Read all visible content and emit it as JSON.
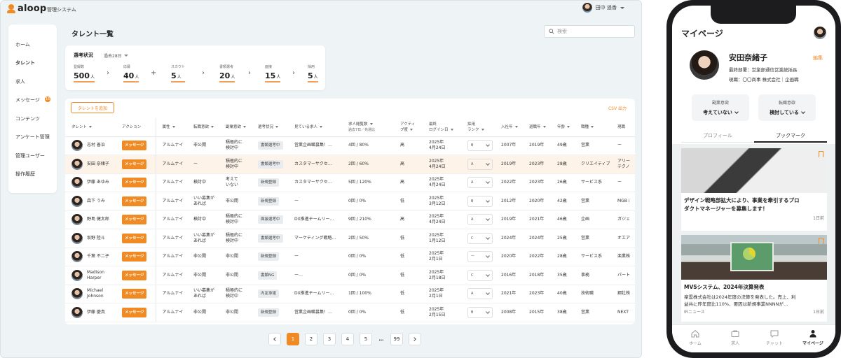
{
  "app": {
    "logo_text": "aloop",
    "system_name": "管理システム",
    "user_name": "田中 遥香"
  },
  "sidebar": {
    "items": [
      {
        "label": "ホーム"
      },
      {
        "label": "タレント",
        "active": true
      },
      {
        "label": "求人"
      },
      {
        "label": "メッセージ",
        "badge": "16"
      },
      {
        "label": "コンテンツ"
      },
      {
        "label": "アンケート管理"
      },
      {
        "label": "管理ユーザー"
      },
      {
        "label": "操作履歴"
      }
    ]
  },
  "page": {
    "title": "タレント一覧",
    "search_placeholder": "検索"
  },
  "status": {
    "title": "選考状況",
    "period": "過去28日",
    "stats": [
      {
        "label": "登録数",
        "value": "500",
        "unit": "人"
      },
      {
        "label": "応募",
        "value": "40",
        "unit": "人"
      },
      {
        "label": "スカウト",
        "value": "5",
        "unit": "人"
      },
      {
        "label": "書類選考",
        "value": "20",
        "unit": "人"
      },
      {
        "label": "面接",
        "value": "15",
        "unit": "人"
      },
      {
        "label": "採用",
        "value": "5",
        "unit": "人"
      }
    ]
  },
  "list": {
    "add_button": "タレントを追加",
    "csv_link": "CSV 出力",
    "headers": {
      "talent": "タレント",
      "action": "アクション",
      "attribute": "属性",
      "job_change": "転職意欲",
      "side_job": "副業意欲",
      "status": "選考状況",
      "viewing": "見ている求人",
      "views_1": "求人閲覧数",
      "views_2": "過去7日／先週比",
      "activity_1": "アクティ",
      "activity_2": "ブ度",
      "last_login_1": "最終",
      "last_login_2": "ログイン日",
      "rank_1": "採用",
      "rank_2": "ランク",
      "join_year": "入社年",
      "leave_year": "退職年",
      "age": "年齢",
      "occupation": "職種",
      "current": "現職"
    },
    "message_label": "メッセージ",
    "rows": [
      {
        "name": "志村 善治",
        "attr": "アルムナイ",
        "job": "非公開",
        "side": "積極的に\n検討中",
        "status": "書類選考中",
        "viewing": "営業企画職募集！…",
        "views": "4回 / 80%",
        "activity": "高",
        "login": "2025年\n4月24日",
        "rank": "B",
        "join": "2007年",
        "leave": "2019年",
        "age": "49歳",
        "occ": "営業",
        "cur": "ー"
      },
      {
        "name": "安田 奈緒子",
        "attr": "アルムナイ",
        "job": "ー",
        "side": "積極的に\n検討中",
        "status": "書類選考中",
        "viewing": "カスタマーサクセ…",
        "views": "2回 / 60%",
        "activity": "高",
        "login": "2025年\n4月24日",
        "rank": "A",
        "join": "2019年",
        "leave": "2023年",
        "age": "28歳",
        "occ": "クリエイティブ",
        "cur": "アリー\nテクノ",
        "highlight": true
      },
      {
        "name": "伊藤 あゆみ",
        "attr": "アルムナイ",
        "job": "検討中",
        "side": "考えて\nいない",
        "status": "新規登録",
        "viewing": "カスタマーサクセ…",
        "views": "5回 / 120%",
        "activity": "高",
        "login": "2025年\n4月24日",
        "rank": "A",
        "join": "2022年",
        "leave": "2023年",
        "age": "26歳",
        "occ": "サービス系",
        "cur": "ー"
      },
      {
        "name": "森下 うみ",
        "attr": "アルムナイ",
        "job": "いい募集が\nあれば",
        "side": "非公開",
        "status": "新規登録",
        "viewing": "ー",
        "views": "0回 / 0%",
        "activity": "低",
        "login": "2025年\n3月12日",
        "rank": "B",
        "join": "2012年",
        "leave": "2020年",
        "age": "42歳",
        "occ": "営業",
        "cur": "MGB i"
      },
      {
        "name": "野島 健太郎",
        "attr": "アルムナイ",
        "job": "検討中",
        "side": "積極的に\n検討中",
        "status": "面接選考中",
        "viewing": "DX推進チームリー…",
        "views": "9回 / 210%",
        "activity": "高",
        "login": "2025年\n4月24日",
        "rank": "A",
        "join": "2019年",
        "leave": "2021年",
        "age": "46歳",
        "occ": "企画",
        "cur": "ガジェ"
      },
      {
        "name": "坂野 陸斗",
        "attr": "アルムナイ",
        "job": "いい募集が\nあれば",
        "side": "積極的に\n検討中",
        "status": "書類選考中",
        "viewing": "マーケティング戦略…",
        "views": "2回 / 50%",
        "activity": "低",
        "login": "2025年\n1月12日",
        "rank": "C",
        "join": "2024年",
        "leave": "2024年",
        "age": "25歳",
        "occ": "営業",
        "cur": "オエア"
      },
      {
        "name": "千葉 不二子",
        "attr": "アルムナイ",
        "job": "非公開",
        "side": "非公開",
        "status": "新規登録",
        "viewing": "ー",
        "views": "0回 / 0%",
        "activity": "低",
        "login": "2025年\n2月1日",
        "rank": "ー",
        "join": "2020年",
        "leave": "2022年",
        "age": "28歳",
        "occ": "サービス系",
        "cur": "楽業株"
      },
      {
        "name": "Madison\nHarper",
        "attr": "アルムナイ",
        "job": "非公開",
        "side": "非公開",
        "status": "書類NG",
        "viewing": "ー…",
        "views": "0回 / 0%",
        "activity": "低",
        "login": "2025年\n2月18日",
        "rank": "C",
        "join": "2016年",
        "leave": "2018年",
        "age": "35歳",
        "occ": "事務",
        "cur": "パート"
      },
      {
        "name": "Michael\nJohnson",
        "attr": "アルムナイ",
        "job": "いい募集が\nあれば",
        "side": "積極的に\n検討中",
        "status": "内定承諾",
        "viewing": "DX推進チームリー…",
        "views": "1回 / 100%",
        "activity": "低",
        "login": "2025年\n2月1日",
        "rank": "A",
        "join": "2021年",
        "leave": "2023年",
        "age": "40歳",
        "occ": "技術職",
        "cur": "鋼牡株"
      },
      {
        "name": "伊藤 慶真",
        "attr": "アルムナイ",
        "job": "非公開",
        "side": "非公開",
        "status": "新規登録",
        "viewing": "営業企画職募集！…",
        "views": "0回 / 0%",
        "activity": "低",
        "login": "2025年\n2月15日",
        "rank": "B",
        "join": "2008年",
        "leave": "2015年",
        "age": "38歳",
        "occ": "営業",
        "cur": "NEXT"
      }
    ]
  },
  "pager": {
    "pages": [
      "1",
      "2",
      "3",
      "4",
      "5",
      "…",
      "99"
    ],
    "current": "1"
  },
  "phone": {
    "title": "マイページ",
    "name": "安田奈緒子",
    "edit": "編集",
    "last_dept": "最終部署：営業部通信営業統括長",
    "current_job": "現職：〇〇商事 株式会社｜企画職",
    "side_intent_label": "副業意欲",
    "side_intent_value": "考えていない",
    "job_intent_label": "転職意欲",
    "job_intent_value": "検討している",
    "tabs": [
      "プロフィール",
      "ブックマーク"
    ],
    "articles": [
      {
        "title": "デザイン戦略部拡大により、事業を牽引するプロ\nダクトマネージャーを募集します！",
        "time": "1日前"
      },
      {
        "title": "MVSシステム、2024年決算発表",
        "body": "楽雲株式会社は2024年度の決算を発表した。売上、利\n益共に昨年度比110%、要因は新規事業NNNNが…",
        "source": "IRニュース",
        "time": "1日前"
      }
    ],
    "nav": [
      "ホーム",
      "求人",
      "チャット",
      "マイページ"
    ]
  },
  "colors": {
    "accent": "#f08a24",
    "highlight_row": "#fdf3e9",
    "tag_bg": "#e9ecee"
  }
}
